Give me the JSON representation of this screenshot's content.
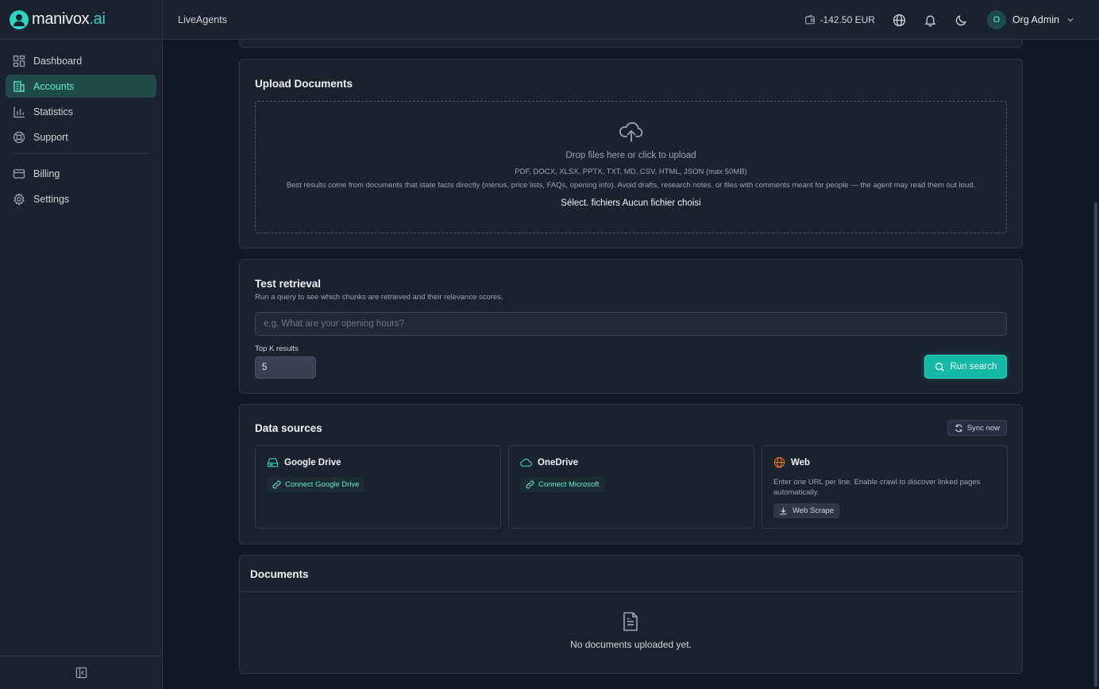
{
  "brand": {
    "name_main": "manivox",
    "name_accent": ".ai"
  },
  "sidebar": {
    "items": [
      {
        "label": "Dashboard",
        "icon": "dashboard-icon",
        "active": false
      },
      {
        "label": "Accounts",
        "icon": "building-icon",
        "active": true
      },
      {
        "label": "Statistics",
        "icon": "bar-chart-icon",
        "active": false
      },
      {
        "label": "Support",
        "icon": "lifebuoy-icon",
        "active": false
      },
      {
        "label": "Billing",
        "icon": "credit-card-icon",
        "active": false
      },
      {
        "label": "Settings",
        "icon": "gear-icon",
        "active": false
      }
    ]
  },
  "header": {
    "title": "LiveAgents",
    "balance": "-142.50 EUR",
    "user_initial": "O",
    "user_name": "Org Admin"
  },
  "upload": {
    "title": "Upload Documents",
    "drop_text": "Drop files here or click to upload",
    "types": "PDF, DOCX, XLSX, PPTX, TXT, MD, CSV, HTML, JSON (max 50MB)",
    "hint": "Best results come from documents that state facts directly (menus, price lists, FAQs, opening info). Avoid drafts, research notes, or files with comments meant for people — the agent may read them out loud.",
    "file_button": "Sélect. fichiers",
    "file_status": "Aucun fichier choisi"
  },
  "test": {
    "title": "Test retrieval",
    "subtitle": "Run a query to see which chunks are retrieved and their relevance scores.",
    "placeholder": "e.g. What are your opening hours?",
    "topk_label": "Top K results",
    "topk_value": "5",
    "run_label": "Run search"
  },
  "datasources": {
    "title": "Data sources",
    "sync_label": "Sync now",
    "google": {
      "name": "Google Drive",
      "connect": "Connect Google Drive"
    },
    "onedrive": {
      "name": "OneDrive",
      "connect": "Connect Microsoft"
    },
    "web": {
      "name": "Web",
      "desc": "Enter one URL per line. Enable crawl to discover linked pages automatically.",
      "scrape": "Web Scrape"
    }
  },
  "documents": {
    "title": "Documents",
    "empty": "No documents uploaded yet."
  },
  "colors": {
    "accent": "#2dd4bf",
    "background": "#111827",
    "panel": "#1a2230",
    "web_icon": "#f97316"
  }
}
